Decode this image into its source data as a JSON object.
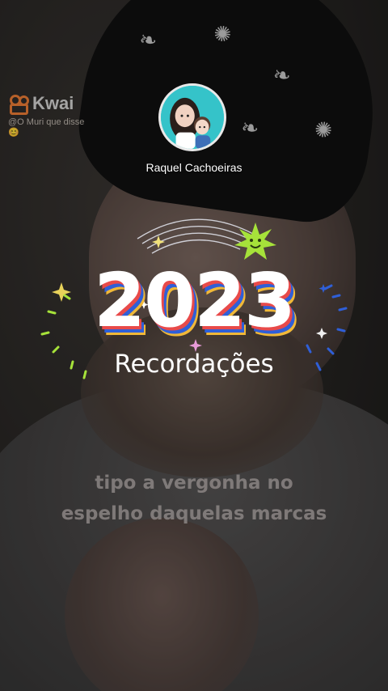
{
  "watermark": {
    "brand": "Kwai",
    "handle": "@O Muri que disse",
    "emoji": "😊"
  },
  "creator": {
    "name": "Raquel Cachoeiras"
  },
  "banner": {
    "year": "2023",
    "subtitle": "Recordações"
  },
  "caption": {
    "line1": "tipo a vergonha no",
    "line2": "espelho daquelas marcas"
  },
  "colors": {
    "year_shadow_red": "#e84a4a",
    "year_shadow_blue": "#2f5fd8",
    "year_shadow_yellow": "#f0b838",
    "sparkle_green": "#a6e23a",
    "sparkle_blue": "#2f5fd8"
  },
  "icons": [
    "kwai-logo-icon",
    "smiley-sun-icon",
    "sparkle-icon"
  ]
}
